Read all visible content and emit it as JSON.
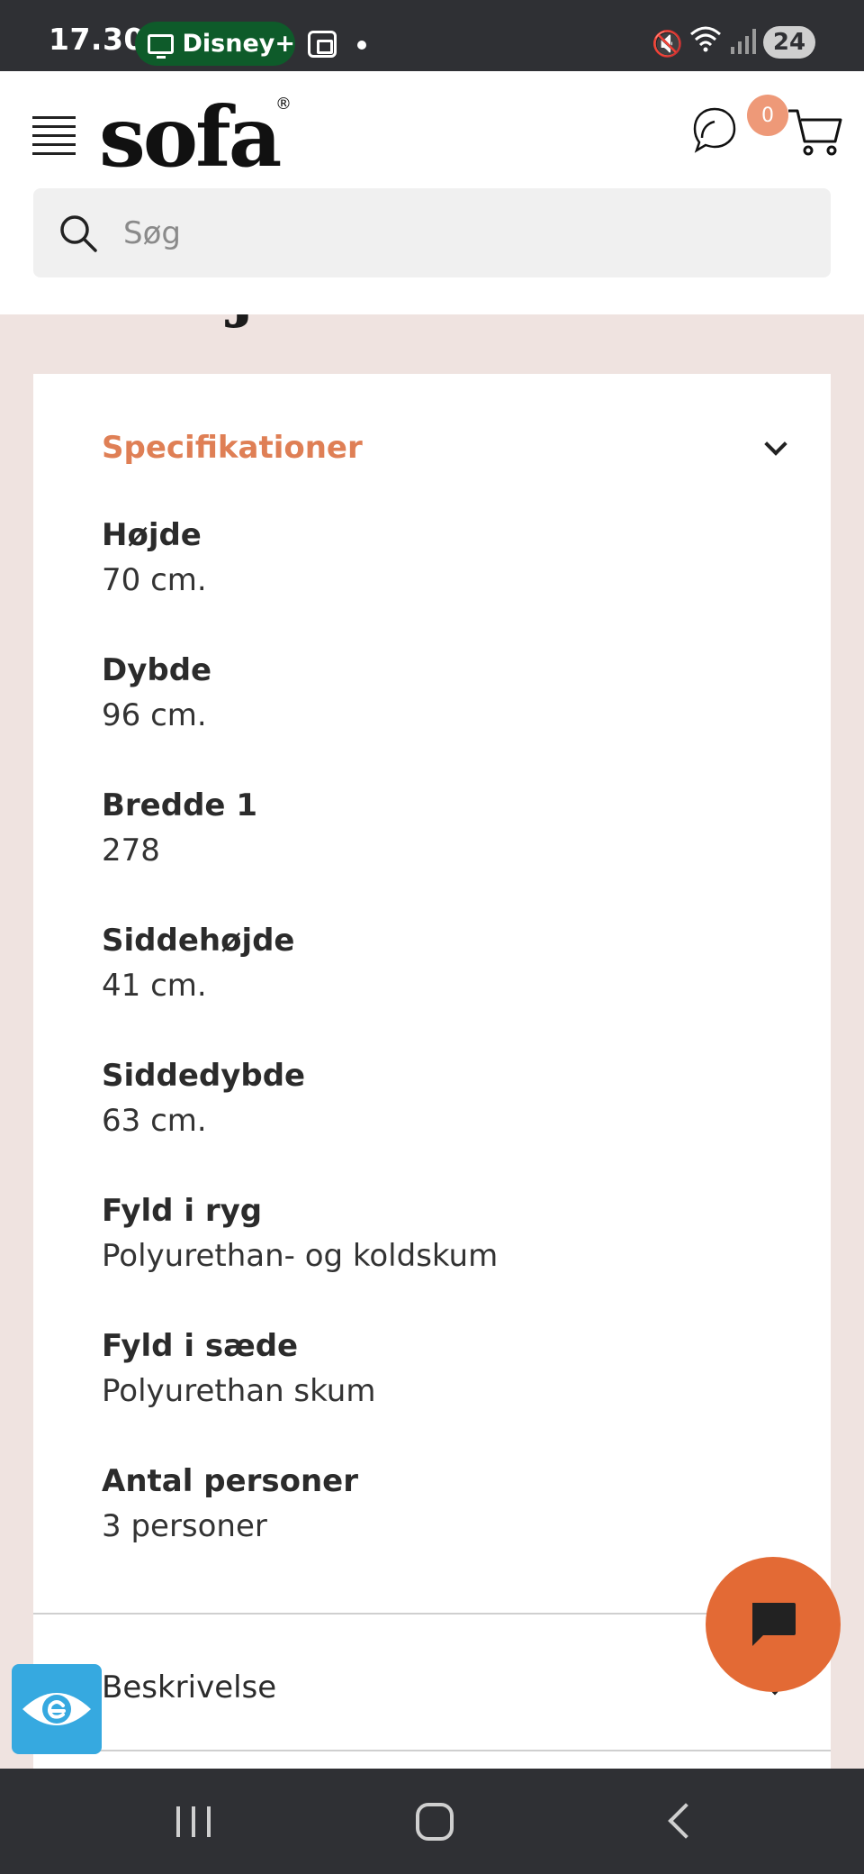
{
  "status_bar": {
    "time": "17.30",
    "app_pill": "Disney+",
    "battery": "24"
  },
  "header": {
    "logo": "sofa",
    "logo_mark": "®",
    "cart_count": "0",
    "search": {
      "placeholder": "Søg",
      "value": ""
    },
    "icons": [
      "menu-icon",
      "chat-bubbles-icon",
      "cart-icon",
      "search-icon"
    ]
  },
  "section": {
    "heading": "Detaljer"
  },
  "specifications": {
    "title": "Specifikationer",
    "items": [
      {
        "label": "Højde",
        "value": "70 cm."
      },
      {
        "label": "Dybde",
        "value": "96 cm."
      },
      {
        "label": "Bredde 1",
        "value": "278"
      },
      {
        "label": "Siddehøjde",
        "value": "41 cm."
      },
      {
        "label": "Siddedybde",
        "value": "63 cm."
      },
      {
        "label": "Fyld i ryg",
        "value": "Polyurethan- og koldskum"
      },
      {
        "label": "Fyld i sæde",
        "value": "Polyurethan skum"
      },
      {
        "label": "Antal personer",
        "value": "3 personer"
      }
    ]
  },
  "description": {
    "label": "Beskrivelse"
  },
  "colors": {
    "accent": "#df7f55",
    "chat_fab": "#e36a35",
    "badge": "#ee9978",
    "accessibility": "#36a9e0",
    "page_bg": "#efe3e0"
  }
}
